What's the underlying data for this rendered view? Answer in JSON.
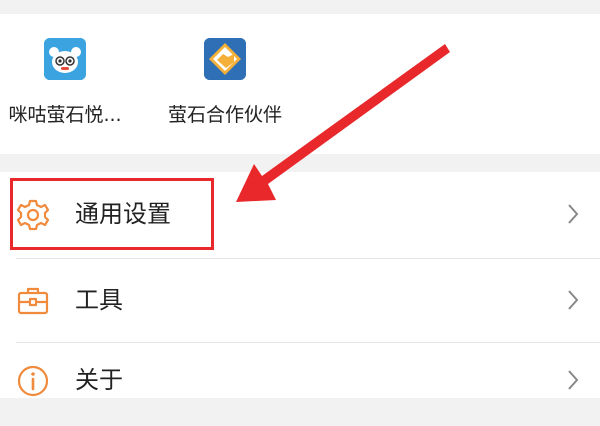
{
  "apps": [
    {
      "label": "咪咕萤石悦...",
      "icon": "migu-mascot-icon"
    },
    {
      "label": "萤石合作伙伴",
      "icon": "handshake-icon"
    }
  ],
  "menu": {
    "items": [
      {
        "label": "通用设置",
        "icon": "gear-icon"
      },
      {
        "label": "工具",
        "icon": "toolbox-icon"
      },
      {
        "label": "关于",
        "icon": "info-icon"
      }
    ]
  },
  "colors": {
    "accent_orange": "#f08a3c",
    "annotation_red": "#e8282b",
    "background": "#f2f2f2",
    "card": "#ffffff"
  }
}
